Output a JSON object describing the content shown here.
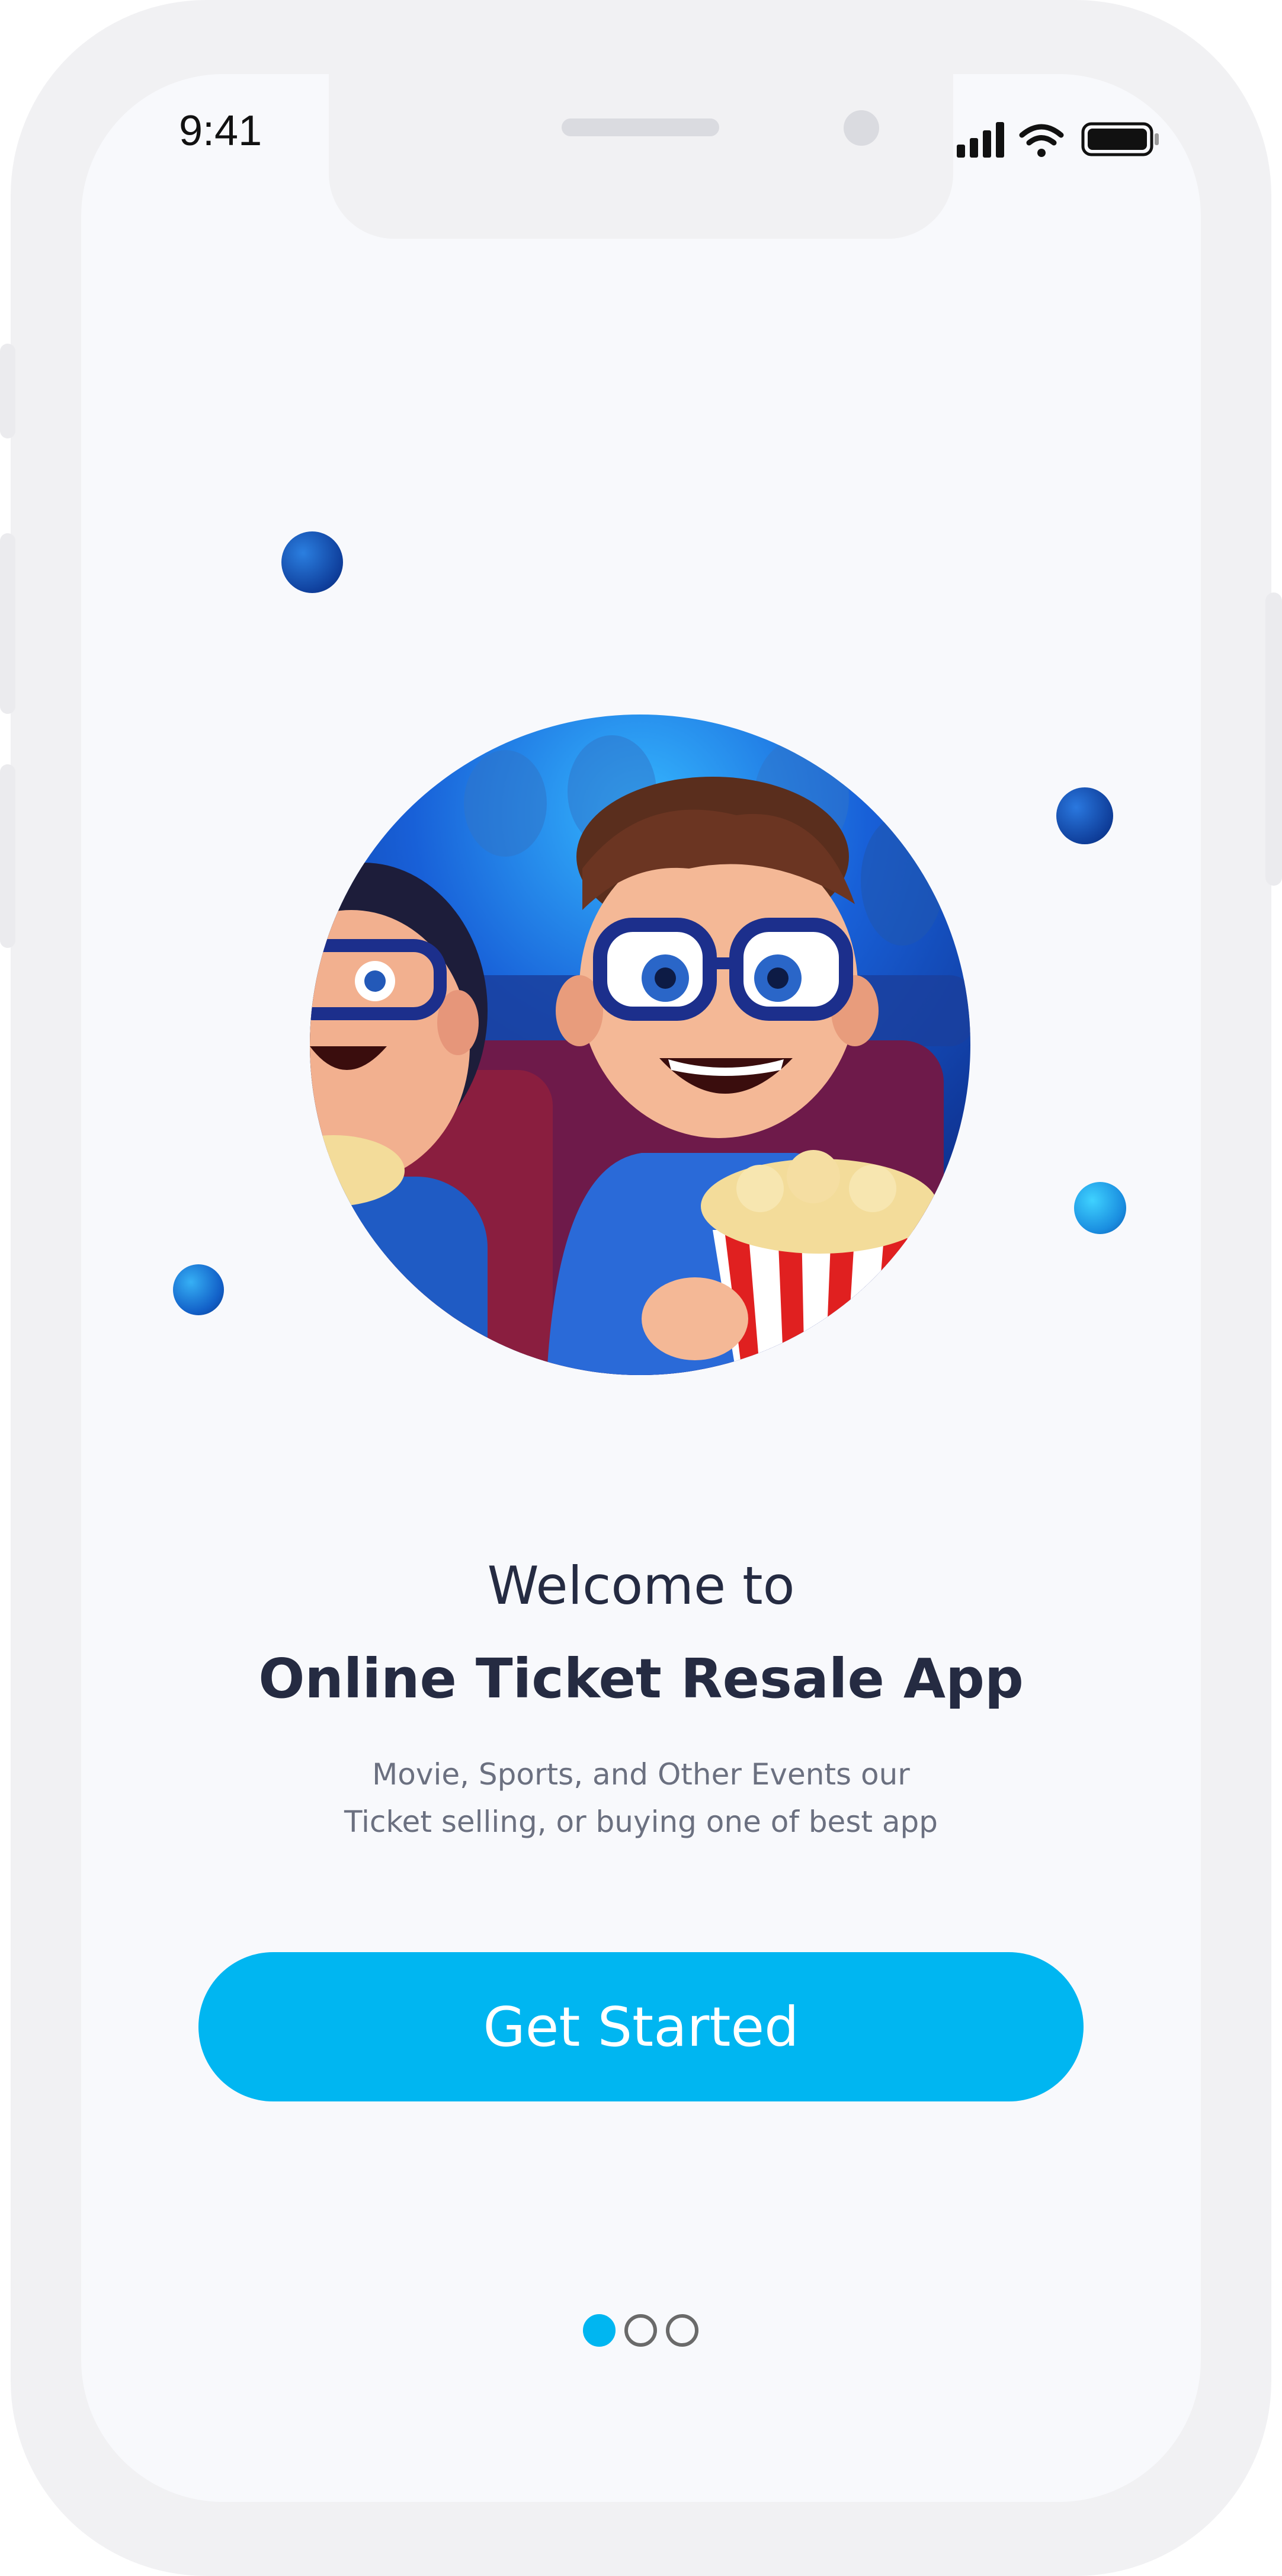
{
  "status_bar": {
    "time": "9:41",
    "icons": [
      "signal-icon",
      "wifi-icon",
      "battery-icon"
    ]
  },
  "welcome": {
    "line1": "Welcome to",
    "line2": "Online Ticket Resale App",
    "subtitle_line1": "Movie, Sports, and Other Events our",
    "subtitle_line2": "Ticket selling, or buying one of best app"
  },
  "cta": {
    "label": "Get Started"
  },
  "pagination": {
    "count": 3,
    "active_index": 0
  },
  "colors": {
    "accent": "#00b6f1",
    "title": "#252b42",
    "subtitle": "#6b7080",
    "screen_bg": "#f8f9fc"
  }
}
